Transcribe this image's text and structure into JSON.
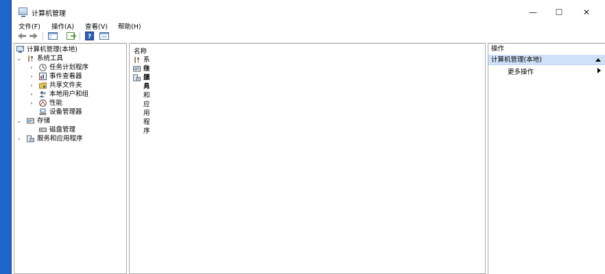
{
  "window": {
    "title": "计算机管理",
    "controls": {
      "minimize": "—",
      "maximize": "☐",
      "close": "✕"
    }
  },
  "menu": [
    "文件(F)",
    "操作(A)",
    "查看(V)",
    "帮助(H)"
  ],
  "toolbar": {
    "icons": [
      "back-arrow-icon",
      "forward-arrow-icon",
      "show-tree-icon",
      "export-list-icon",
      "help-icon",
      "properties-icon"
    ]
  },
  "tree": {
    "root": "计算机管理(本地)",
    "items": [
      {
        "label": "系统工具",
        "level": 1,
        "expander": "⌄"
      },
      {
        "label": "任务计划程序",
        "level": 2,
        "expander": "›"
      },
      {
        "label": "事件查看器",
        "level": 2,
        "expander": "›"
      },
      {
        "label": "共享文件夹",
        "level": 2,
        "expander": "›"
      },
      {
        "label": "本地用户和组",
        "level": 2,
        "expander": "›"
      },
      {
        "label": "性能",
        "level": 2,
        "expander": "›"
      },
      {
        "label": "设备管理器",
        "level": 2,
        "expander": ""
      },
      {
        "label": "存储",
        "level": 1,
        "expander": "⌄"
      },
      {
        "label": "磁盘管理",
        "level": 2,
        "expander": ""
      },
      {
        "label": "服务和应用程序",
        "level": 1,
        "expander": "›"
      }
    ]
  },
  "list": {
    "header": "名称",
    "items": [
      "系统工具",
      "存储",
      "服务和应用程序"
    ]
  },
  "actions": {
    "header": "操作",
    "section": "计算机管理(本地)",
    "items": [
      "更多操作"
    ]
  }
}
